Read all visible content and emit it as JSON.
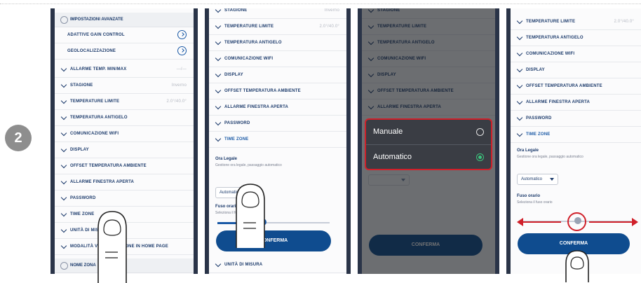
{
  "step_number": "2",
  "screen1": {
    "section_title": "IMPOSTAZIONI AVANZATE",
    "sub_items": [
      "ADATTIVE GAIN CONTROL",
      "GEOLOCALIZZAZIONE"
    ],
    "rows": [
      {
        "label": "ALLARME TEMP. MIN/MAX",
        "value": "—/—"
      },
      {
        "label": "STAGIONE",
        "value": "Inverno"
      },
      {
        "label": "TEMPERATURE LIMITE",
        "value": "2.0°/40.0°"
      },
      {
        "label": "TEMPERATURA ANTIGELO",
        "value": ""
      },
      {
        "label": "COMUNICAZIONE WIFI",
        "value": ""
      },
      {
        "label": "DISPLAY",
        "value": ""
      },
      {
        "label": "OFFSET TEMPERATURA AMBIENTE",
        "value": ""
      },
      {
        "label": "ALLARME FINESTRA APERTA",
        "value": ""
      },
      {
        "label": "PASSWORD",
        "value": ""
      },
      {
        "label": "TIME ZONE",
        "value": ""
      },
      {
        "label": "UNITÀ DI MISURA",
        "value": ""
      },
      {
        "label": "MODALITÀ VISUALIZZAZIONE IN HOME PAGE",
        "value": ""
      }
    ],
    "bottom_section": "NOME ZONA"
  },
  "screen2": {
    "rows": [
      {
        "label": "STAGIONE",
        "value": "Inverno"
      },
      {
        "label": "TEMPERATURE LIMITE",
        "value": "2.0°/40.0°"
      },
      {
        "label": "TEMPERATURA ANTIGELO",
        "value": ""
      },
      {
        "label": "COMUNICAZIONE WIFI",
        "value": ""
      },
      {
        "label": "DISPLAY",
        "value": ""
      },
      {
        "label": "OFFSET TEMPERATURA AMBIENTE",
        "value": ""
      },
      {
        "label": "ALLARME FINESTRA APERTA",
        "value": ""
      },
      {
        "label": "PASSWORD",
        "value": ""
      },
      {
        "label": "TIME ZONE",
        "value": ""
      }
    ],
    "legal_time_title": "Ora Legale",
    "legal_time_desc": "Gestione ora legale, passaggio automatico",
    "select_value": "Automatico",
    "timezone_title": "Fuso orario",
    "timezone_desc": "Seleziona il fuso orario",
    "confirm_label": "CONFERMA",
    "bottom_row": "UNITÀ DI MISURA"
  },
  "screen3": {
    "rows": [
      "STAGIONE",
      "TEMPERATURE LIMITE",
      "TEMPERATURA ANTIGELO",
      "COMUNICAZIONE WIFI",
      "DISPLAY",
      "OFFSET TEMPERATURA AMBIENTE",
      "ALLARME FINESTRA APERTA"
    ],
    "popup_options": [
      {
        "label": "Manuale",
        "selected": false
      },
      {
        "label": "Automatico",
        "selected": true
      }
    ],
    "confirm_label": "CONFERMA"
  },
  "screen4": {
    "rows": [
      {
        "label": "TEMPERATURE LIMITE",
        "value": "2.0°/40.0°"
      },
      {
        "label": "TEMPERATURA ANTIGELO",
        "value": ""
      },
      {
        "label": "COMUNICAZIONE WIFI",
        "value": ""
      },
      {
        "label": "DISPLAY",
        "value": ""
      },
      {
        "label": "OFFSET TEMPERATURA AMBIENTE",
        "value": ""
      },
      {
        "label": "ALLARME FINESTRA APERTA",
        "value": ""
      },
      {
        "label": "PASSWORD",
        "value": ""
      },
      {
        "label": "TIME ZONE",
        "value": ""
      }
    ],
    "legal_time_title": "Ora Legale",
    "legal_time_desc": "Gestione ora legale, passaggio automatico",
    "select_value": "Automatico",
    "timezone_title": "Fuso orario",
    "timezone_desc": "Seleziona il fuso orario",
    "confirm_label": "CONFERMA"
  },
  "colors": {
    "accent_red": "#d0202a",
    "primary_blue": "#0f4c8f",
    "radio_green": "#3cc47d"
  }
}
